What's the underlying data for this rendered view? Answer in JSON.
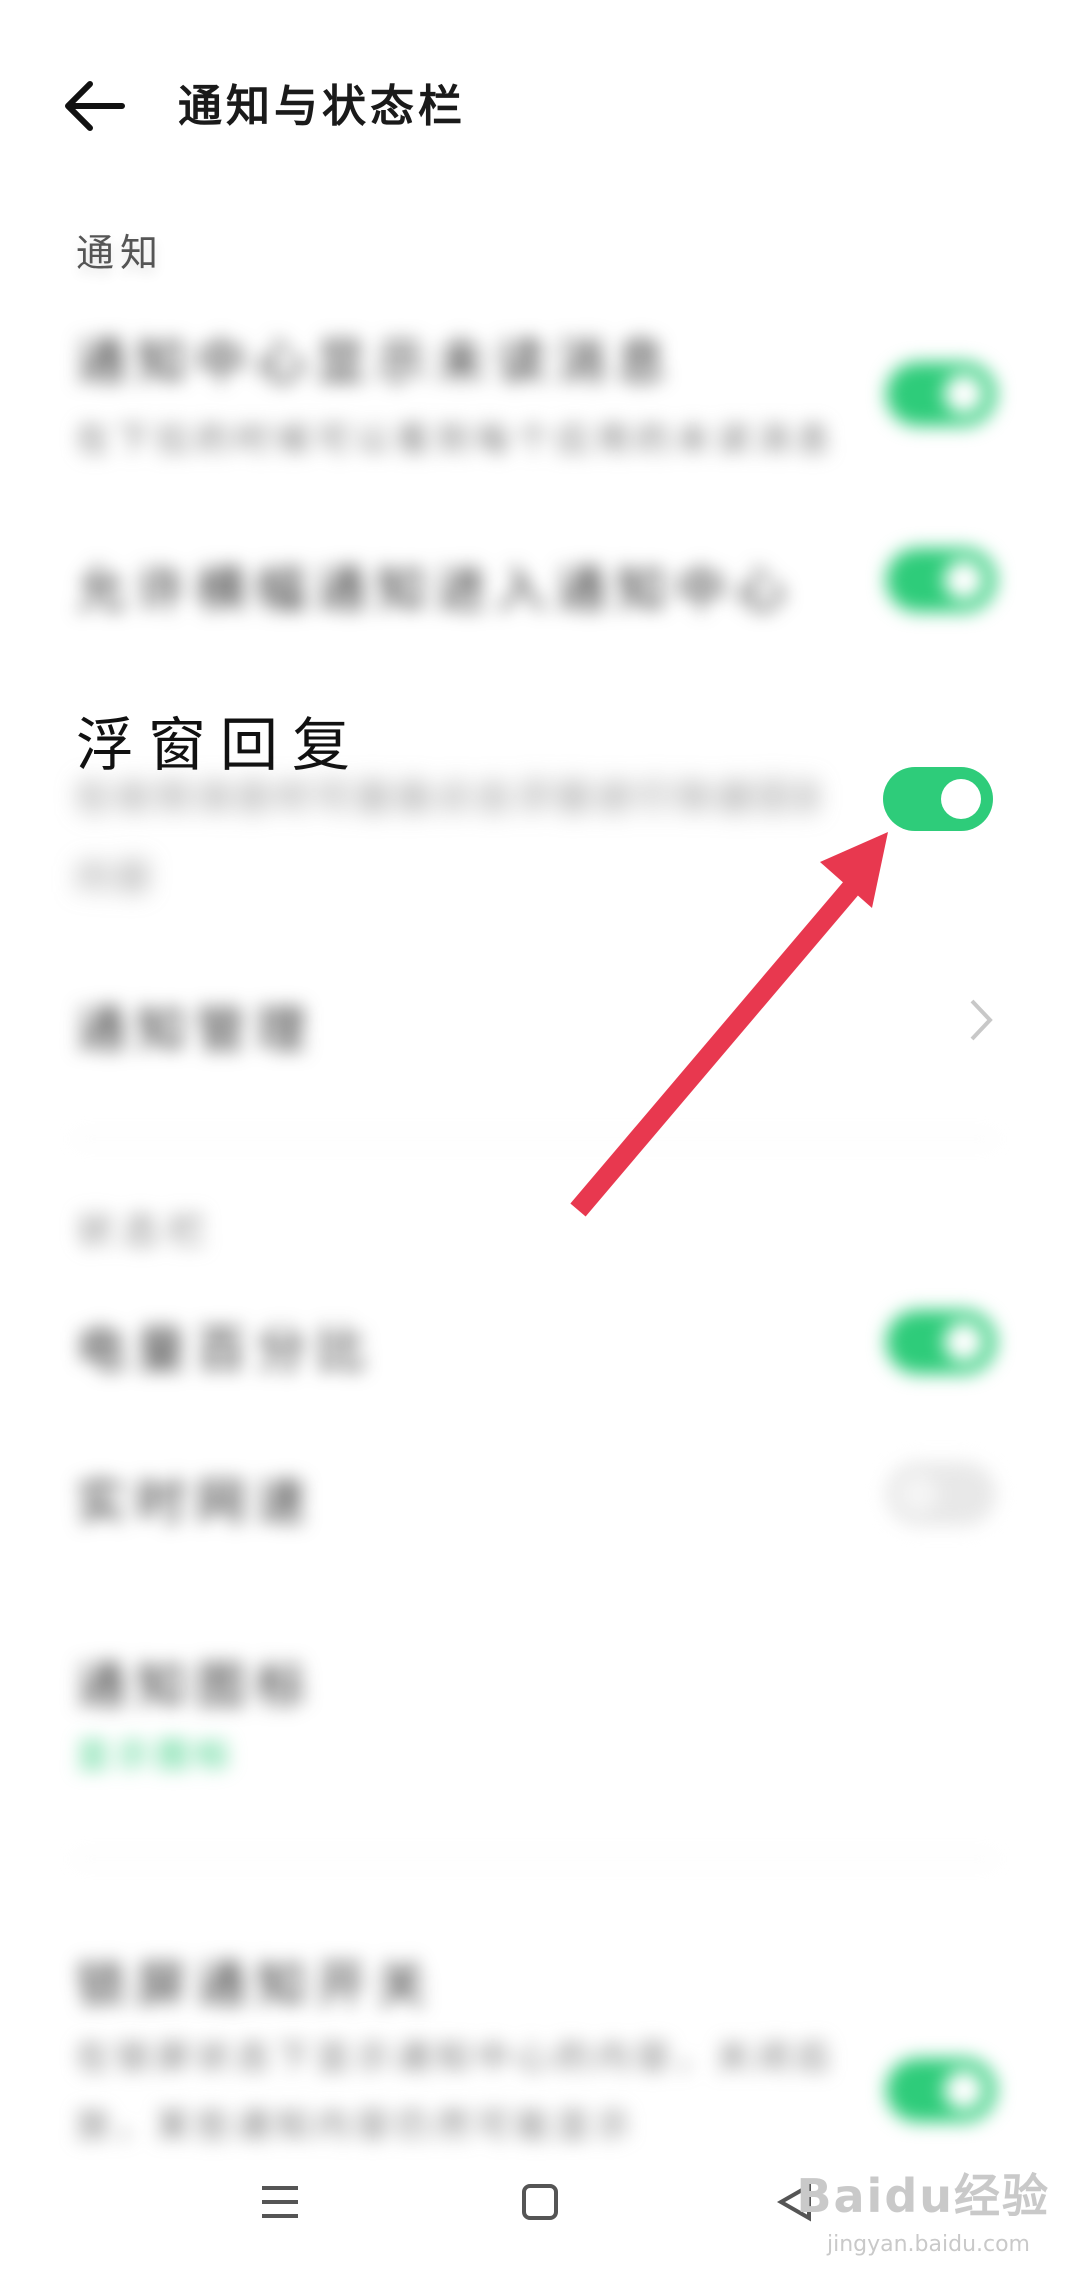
{
  "header": {
    "title": "通知与状态栏"
  },
  "sections": {
    "notify_label": "通知",
    "other_label": "状态栏"
  },
  "items": {
    "item1": {
      "title": "通知中心显示未读消息",
      "subtitle": "在下拉的时候可以看到每个应用的未读消息数",
      "toggle": "on"
    },
    "item2": {
      "title": "允许横幅通知进入通知中心",
      "toggle": "on"
    },
    "float_reply": {
      "title": "浮窗回复",
      "subtitle": "在收到消息时可直接点击浮窗进行快速回复消息内容",
      "subtitle2": "内容",
      "toggle": "on"
    },
    "notify_manage": {
      "title": "通知管理"
    },
    "item5": {
      "title": "电量百分比",
      "toggle": "on"
    },
    "item6": {
      "title": "实时网速",
      "toggle": "off"
    },
    "item7": {
      "title": "通知图标",
      "subtitle": "显示图标"
    },
    "item8": {
      "title": "锁屏通知开关",
      "subtitle": "在锁屏状态下显示通知中心的内容，关闭后将不显示",
      "subtitle_tail": "放，某些通知内容仍然可能显示"
    }
  },
  "annotation": {
    "arrow_color": "#e8384f"
  },
  "watermark": {
    "brand": "Baidu经验",
    "url": "jingyan.baidu.com"
  },
  "colors": {
    "toggle_on": "#2ecc7a",
    "accent_green": "#2ecc7a"
  }
}
